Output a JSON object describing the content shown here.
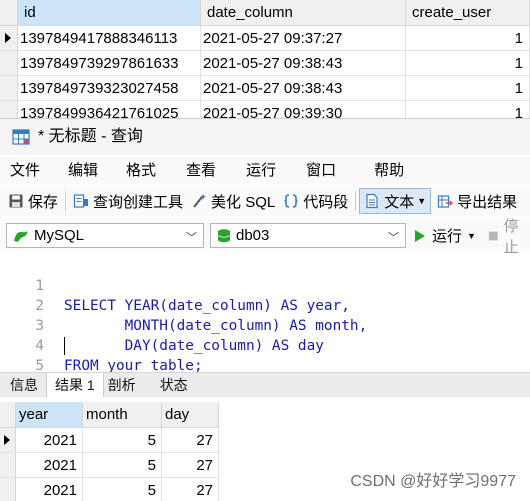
{
  "background_grid": {
    "columns": [
      "id",
      "date_column",
      "create_user"
    ],
    "rows": [
      [
        "1397849417888346113",
        "2021-05-27 09:37:27",
        "1"
      ],
      [
        "1397849739297861633",
        "2021-05-27 09:38:43",
        "1"
      ],
      [
        "1397849739323027458",
        "2021-05-27 09:38:43",
        "1"
      ],
      [
        "1397849936421761025",
        "2021-05-27 09:39:30",
        "1"
      ]
    ]
  },
  "window": {
    "title": "* 无标题 - 查询"
  },
  "menu": [
    "文件",
    "编辑",
    "格式",
    "查看",
    "运行",
    "窗口",
    "帮助"
  ],
  "toolbar": {
    "save": "保存",
    "query_builder": "查询创建工具",
    "beautify": "美化 SQL",
    "snippet": "代码段",
    "text": "文本",
    "export": "导出结果"
  },
  "connection": {
    "engine": "MySQL",
    "database": "db03",
    "run": "运行",
    "stop": "停止"
  },
  "editor": {
    "line_numbers": [
      "1",
      "2",
      "3",
      "4",
      "5"
    ],
    "lines": [
      "SELECT YEAR(date_column) AS year,",
      "       MONTH(date_column) AS month,",
      "       DAY(date_column) AS day",
      "FROM your_table;",
      ""
    ]
  },
  "result_tabs": [
    "信息",
    "结果 1",
    "剖析",
    "状态"
  ],
  "result_grid": {
    "columns": [
      "year",
      "month",
      "day"
    ],
    "rows": [
      [
        "2021",
        "5",
        "27"
      ],
      [
        "2021",
        "5",
        "27"
      ],
      [
        "2021",
        "5",
        "27"
      ]
    ]
  },
  "watermark": "CSDN @好好学习9977",
  "colors": {
    "selected_header": "#cce4f7",
    "keyword_blue": "#2f2fd0",
    "run_green": "#2aa32a"
  }
}
